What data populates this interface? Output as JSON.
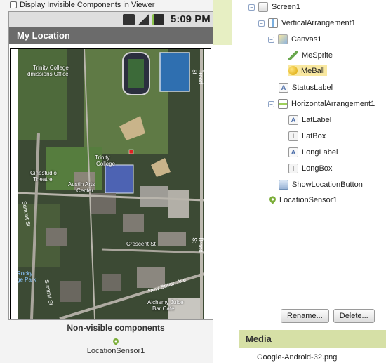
{
  "viewer": {
    "invisible_toggle_label": "Display Invisible Components in Viewer",
    "status_time": "5:09 PM",
    "screen_title": "My Location",
    "nonvisible_title": "Non-visible components",
    "nonvisible_item": "LocationSensor1"
  },
  "map_labels": {
    "trinity_college_top": "Trinity College",
    "admissions": "dmissions Office",
    "trinity_college_mid": "Trinity",
    "college": "College",
    "cinestudio": "Cinestudio",
    "theatre": "Theatre",
    "austin": "Austin Arts",
    "center": "Center",
    "summit1": "Summit St",
    "summit2": "Summit St",
    "crescent": "Crescent St",
    "new_britain": "New Britain Ave",
    "alchemy": "Alchemy Juice",
    "bar": "Bar Cafe",
    "rocky1": "Rocky",
    "rocky2": "ge Park",
    "broad1": "Broad St",
    "broad2": "Broad St"
  },
  "tree": {
    "items": [
      {
        "label": "Screen1",
        "icon": "screen-icon",
        "toggle": "−"
      },
      {
        "label": "VerticalArrangement1",
        "icon": "vertical-arrangement-icon",
        "toggle": "−"
      },
      {
        "label": "Canvas1",
        "icon": "canvas-icon",
        "toggle": "−"
      },
      {
        "label": "MeSprite",
        "icon": "sprite-icon"
      },
      {
        "label": "MeBall",
        "icon": "ball-icon",
        "selected": true
      },
      {
        "label": "StatusLabel",
        "icon": "label-icon"
      },
      {
        "label": "HorizontalArrangement1",
        "icon": "horizontal-arrangement-icon",
        "toggle": "−"
      },
      {
        "label": "LatLabel",
        "icon": "label-icon"
      },
      {
        "label": "LatBox",
        "icon": "textbox-icon"
      },
      {
        "label": "LongLabel",
        "icon": "label-icon"
      },
      {
        "label": "LongBox",
        "icon": "textbox-icon"
      },
      {
        "label": "ShowLocationButton",
        "icon": "button-icon"
      },
      {
        "label": "LocationSensor1",
        "icon": "location-pin-icon"
      }
    ],
    "rename_label": "Rename...",
    "delete_label": "Delete..."
  },
  "media": {
    "header": "Media",
    "files": [
      "Google-Android-32.png"
    ]
  },
  "colors": {
    "title_bar": "#6b6b6b",
    "media_header": "#d6e0a6",
    "selected": "#f9e8a0"
  }
}
